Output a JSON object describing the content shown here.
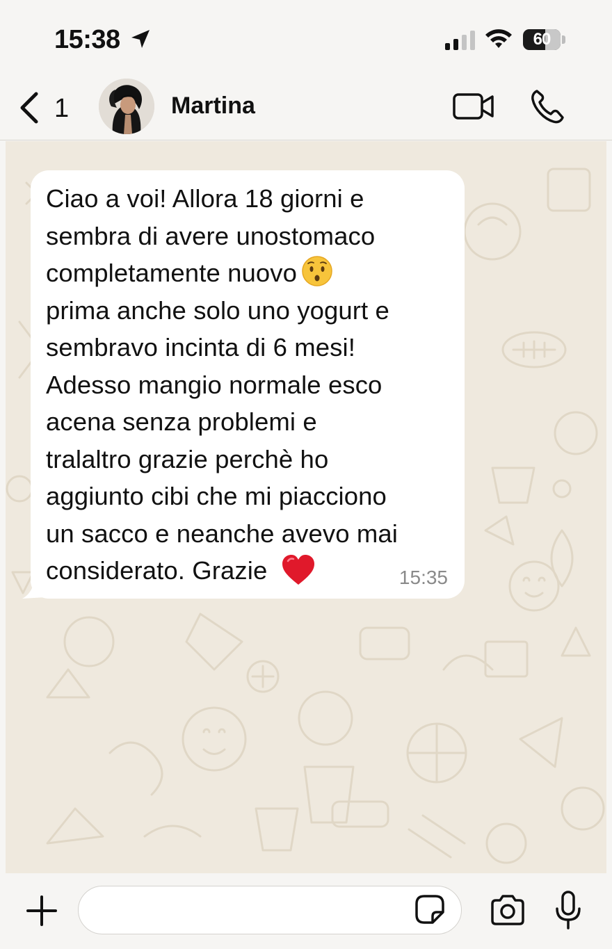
{
  "status_bar": {
    "time": "15:38",
    "battery_level": "60",
    "icons": [
      "location-arrow-icon",
      "signal-bars-icon",
      "wifi-icon",
      "battery-icon"
    ]
  },
  "header": {
    "back_count": "1",
    "contact_name": "Martina",
    "icons": [
      "chevron-left-icon",
      "video-camera-icon",
      "phone-icon"
    ]
  },
  "message": {
    "lines": [
      "Ciao a voi! Allora 18 giorni e",
      "sembra di avere unostomaco",
      "completamente nuovo",
      "prima anche solo uno yogurt e",
      "sembravo incinta di 6 mesi!",
      "Adesso mangio normale esco",
      "acena senza problemi e",
      "tralaltro grazie perchè ho",
      "aggiunto cibi che mi piacciono",
      "un sacco e neanche avevo mai",
      "considerato. Grazie"
    ],
    "time": "15:35",
    "emojis": [
      "hushed-face-emoji",
      "red-heart-emoji"
    ]
  },
  "input_bar": {
    "value": "",
    "placeholder": "",
    "icons": [
      "plus-icon",
      "sticker-icon",
      "camera-icon",
      "microphone-icon"
    ]
  },
  "colors": {
    "background": "#f6f5f3",
    "chat_wallpaper": "#efe9de",
    "bubble": "#ffffff",
    "heart": "#e0192b",
    "timestamp": "#8a8a8a"
  }
}
